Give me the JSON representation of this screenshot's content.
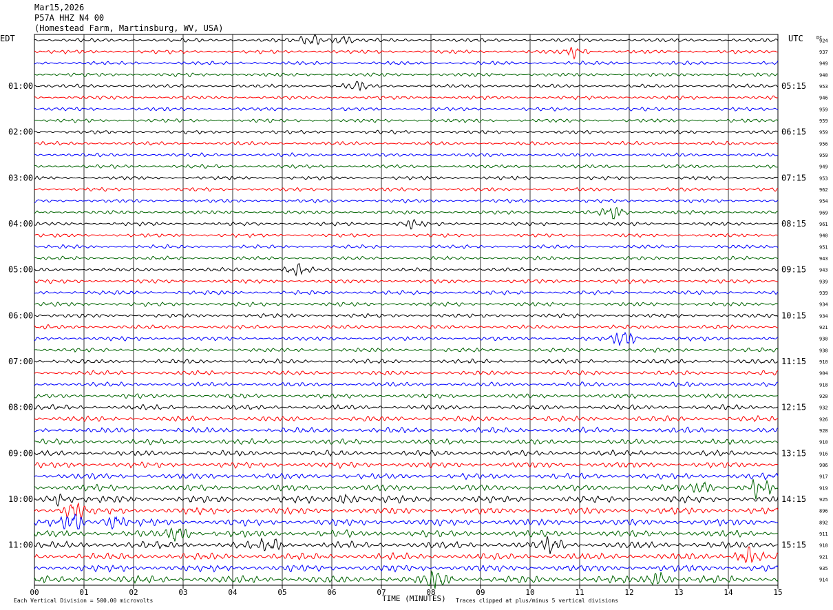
{
  "header": {
    "date": "Mar15,2026",
    "station": "P57A HHZ N4 00",
    "location": "(Homestead Farm, Martinsburg, WV, USA)"
  },
  "labels": {
    "left_tz": "EDT",
    "right_tz": "UTC",
    "dc_header": "DC",
    "x_axis_title": "TIME (MINUTES)",
    "footer_left": "Each Vertical Division =  500.00 microvolts",
    "footer_right": "Traces clipped at plus/minus 5 vertical divisions"
  },
  "colors": {
    "trace_cycle": [
      "#000000",
      "#ff0000",
      "#0000ff",
      "#006400"
    ],
    "grid": "#000000",
    "background": "#ffffff"
  },
  "chart_data": {
    "type": "line",
    "title": "Mar15,2026  P57A HHZ N4 00  (Homestead Farm, Martinsburg, WV, USA)",
    "xlabel": "TIME (MINUTES)",
    "ylabel": "",
    "xlim": [
      0,
      15
    ],
    "x_ticks": [
      "00",
      "01",
      "02",
      "03",
      "04",
      "05",
      "06",
      "07",
      "08",
      "09",
      "10",
      "11",
      "12",
      "13",
      "14",
      "15"
    ],
    "row_minutes": 15,
    "rows": 48,
    "left_hour_labels": [
      "01:00",
      "02:00",
      "03:00",
      "04:00",
      "05:00",
      "06:00",
      "07:00",
      "08:00",
      "09:00",
      "10:00",
      "11:00"
    ],
    "right_hour_labels": [
      "05:15",
      "06:15",
      "07:15",
      "08:15",
      "09:15",
      "10:15",
      "11:15",
      "12:15",
      "13:15",
      "14:15",
      "15:15"
    ],
    "dc_offsets": [
      924,
      937,
      949,
      940,
      953,
      946,
      959,
      959,
      959,
      956,
      959,
      949,
      953,
      962,
      954,
      969,
      961,
      940,
      951,
      943,
      943,
      939,
      939,
      934,
      934,
      921,
      930,
      938,
      910,
      904,
      918,
      920,
      932,
      926,
      928,
      910,
      916,
      906,
      917,
      919,
      925,
      896,
      892,
      911,
      918,
      921,
      935,
      914
    ],
    "amplitude_level": [
      0.8,
      0.8,
      0.8,
      0.8,
      0.8,
      0.8,
      0.8,
      0.8,
      0.8,
      0.8,
      0.8,
      0.8,
      0.8,
      0.8,
      0.8,
      0.8,
      0.8,
      0.8,
      0.8,
      0.8,
      0.8,
      0.9,
      0.9,
      0.9,
      0.9,
      0.9,
      0.9,
      0.9,
      1.0,
      1.0,
      1.0,
      1.0,
      1.1,
      1.2,
      1.2,
      1.2,
      1.2,
      1.3,
      1.3,
      1.4,
      1.5,
      1.5,
      1.5,
      1.5,
      1.5,
      1.5,
      1.5,
      1.6
    ],
    "bursts": [
      {
        "row": 0,
        "minute": 5.6,
        "amp": 2.2
      },
      {
        "row": 0,
        "minute": 6.2,
        "amp": 1.6
      },
      {
        "row": 1,
        "minute": 10.9,
        "amp": 1.8
      },
      {
        "row": 4,
        "minute": 6.5,
        "amp": 1.5
      },
      {
        "row": 15,
        "minute": 11.7,
        "amp": 2.5
      },
      {
        "row": 16,
        "minute": 7.6,
        "amp": 1.6
      },
      {
        "row": 20,
        "minute": 5.3,
        "amp": 2.0
      },
      {
        "row": 26,
        "minute": 11.9,
        "amp": 3.0
      },
      {
        "row": 39,
        "minute": 13.5,
        "amp": 2.0
      },
      {
        "row": 39,
        "minute": 14.6,
        "amp": 2.8
      },
      {
        "row": 40,
        "minute": 0.5,
        "amp": 2.0
      },
      {
        "row": 40,
        "minute": 6.3,
        "amp": 1.8
      },
      {
        "row": 41,
        "minute": 0.8,
        "amp": 3.0
      },
      {
        "row": 42,
        "minute": 0.8,
        "amp": 3.2
      },
      {
        "row": 42,
        "minute": 1.6,
        "amp": 2.5
      },
      {
        "row": 43,
        "minute": 2.9,
        "amp": 2.5
      },
      {
        "row": 44,
        "minute": 4.8,
        "amp": 2.2
      },
      {
        "row": 44,
        "minute": 10.4,
        "amp": 2.2
      },
      {
        "row": 45,
        "minute": 14.4,
        "amp": 2.8
      },
      {
        "row": 47,
        "minute": 8.1,
        "amp": 2.8
      },
      {
        "row": 47,
        "minute": 12.6,
        "amp": 2.4
      }
    ]
  }
}
